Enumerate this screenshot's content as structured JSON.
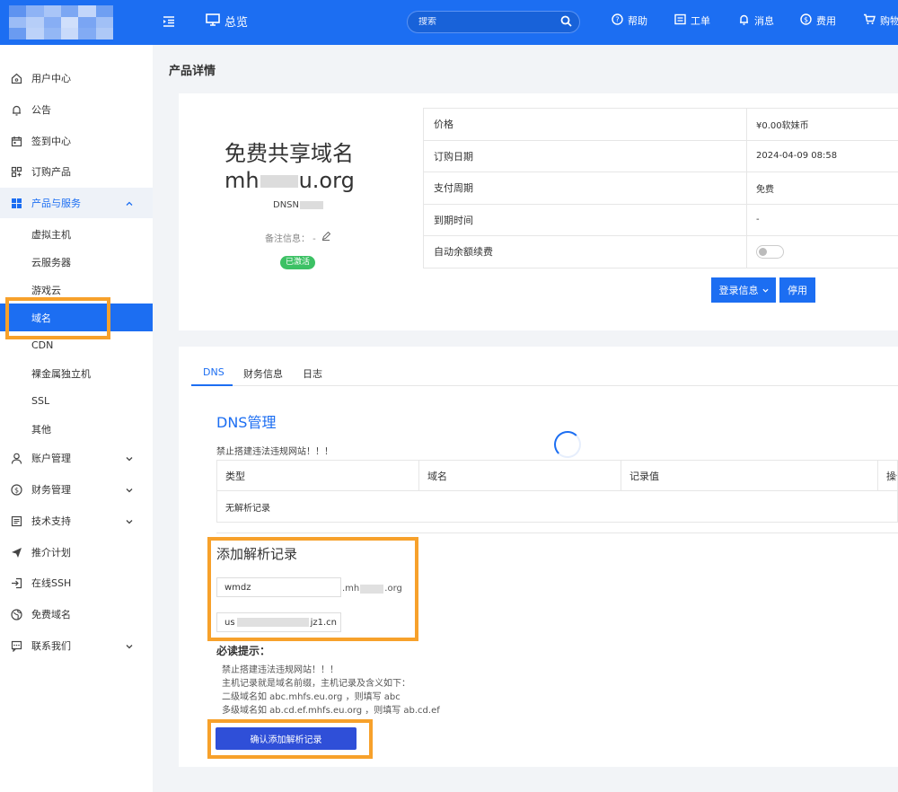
{
  "topbar": {
    "overview": "总览",
    "search_placeholder": "搜索",
    "help": "帮助",
    "ticket": "工单",
    "messages": "消息",
    "fees": "费用",
    "cart": "购物",
    "color": "#1c6ef2"
  },
  "sidebar": {
    "items": [
      {
        "label": "用户中心",
        "icon": "home-icon"
      },
      {
        "label": "公告",
        "icon": "bell-icon"
      },
      {
        "label": "签到中心",
        "icon": "calendar-icon"
      },
      {
        "label": "订购产品",
        "icon": "grid-plus-icon"
      },
      {
        "label": "产品与服务",
        "icon": "apps-icon"
      }
    ],
    "sub_items": [
      "虚拟主机",
      "云服务器",
      "游戏云",
      "域名",
      "CDN",
      "裸金属独立机",
      "SSL",
      "其他"
    ],
    "items_after": [
      {
        "label": "账户管理",
        "icon": "user-icon"
      },
      {
        "label": "财务管理",
        "icon": "dollar-icon"
      },
      {
        "label": "技术支持",
        "icon": "list-icon"
      },
      {
        "label": "推介计划",
        "icon": "send-icon"
      },
      {
        "label": "在线SSH",
        "icon": "login-icon"
      },
      {
        "label": "免费域名",
        "icon": "globe-icon"
      },
      {
        "label": "联系我们",
        "icon": "chat-icon"
      }
    ]
  },
  "page": {
    "title": "产品详情"
  },
  "product": {
    "name": "免费共享域名",
    "domain_prefix": "mh",
    "domain_suffix": "u.org",
    "code": "DNSN",
    "note": "备注信息： -",
    "status": "已激活",
    "info": [
      {
        "key": "价格",
        "value": "¥0.00软妹币"
      },
      {
        "key": "订购日期",
        "value": "2024-04-09 08:58"
      },
      {
        "key": "支付周期",
        "value": "免费"
      },
      {
        "key": "到期时间",
        "value": "-"
      },
      {
        "key": "自动余额续费",
        "value": ""
      }
    ],
    "login_info_btn": "登录信息",
    "disable_btn": "停用"
  },
  "tabs": [
    "DNS",
    "财务信息",
    "日志"
  ],
  "dns": {
    "title": "DNS管理",
    "warning": "禁止搭建违法违规网站！！！",
    "columns": [
      "类型",
      "域名",
      "记录值",
      "操作"
    ],
    "empty": "无解析记录",
    "add_title": "添加解析记录",
    "host_value": "wmdz",
    "suffix_prefix": ".mh",
    "suffix_end": ".org",
    "record_prefix": "us",
    "record_suffix": "jz1.cn",
    "must_read": "必读提示：",
    "tips": [
      "禁止搭建违法违规网站！！！",
      "主机记录就是域名前缀，主机记录及含义如下：",
      "二级域名如 abc.mhfs.eu.org ，则填写 abc",
      "多级域名如 ab.cd.ef.mhfs.eu.org ，则填写 ab.cd.ef"
    ],
    "confirm_btn": "确认添加解析记录"
  }
}
